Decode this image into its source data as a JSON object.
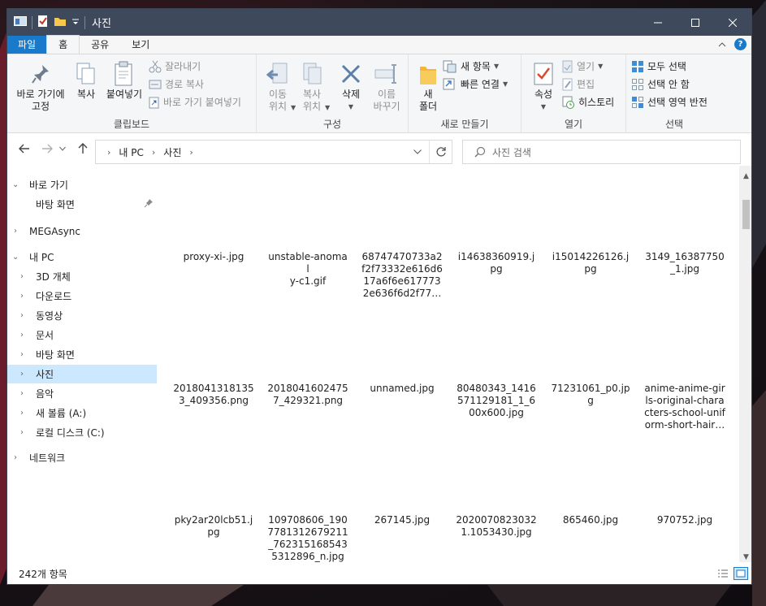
{
  "window": {
    "title": "사진",
    "controls": {
      "minimize": "minimize-icon",
      "maximize": "maximize-icon",
      "close": "close-icon"
    }
  },
  "ribbon_tabs": [
    "파일",
    "홈",
    "공유",
    "보기"
  ],
  "ribbon": {
    "clipboard": {
      "label": "클립보드",
      "pin": "바로 가기에\n고정",
      "copy": "복사",
      "paste": "붙여넣기",
      "cut": "잘라내기",
      "copy_path": "경로 복사",
      "paste_shortcut": "바로 가기 붙여넣기"
    },
    "organize": {
      "label": "구성",
      "move_to": "이동\n위치",
      "copy_to": "복사\n위치",
      "delete": "삭제",
      "rename": "이름\n바꾸기"
    },
    "new": {
      "label": "새로 만들기",
      "new_folder": "새\n폴더",
      "new_item": "새 항목",
      "easy_access": "빠른 연결"
    },
    "open": {
      "label": "열기",
      "properties": "속성",
      "open": "열기",
      "edit": "편집",
      "history": "히스토리"
    },
    "select": {
      "label": "선택",
      "select_all": "모두 선택",
      "select_none": "선택 안 함",
      "invert": "선택 영역 반전"
    }
  },
  "address": {
    "path": [
      "내 PC",
      "사진"
    ],
    "search_placeholder": "사진 검색"
  },
  "nav": {
    "quick_access": "바로 가기",
    "desktop_pinned": "바탕 화면",
    "megasync": "MEGAsync",
    "this_pc": "내 PC",
    "pc_items": [
      "3D 개체",
      "다운로드",
      "동영상",
      "문서",
      "바탕 화면",
      "사진",
      "음악",
      "새 볼륨 (A:)",
      "로컬 디스크 (C:)"
    ],
    "network": "네트워크",
    "selected": "사진"
  },
  "files": [
    [
      "proxy-xi-.jpg",
      "unstable-anomal\ny-c1.gif",
      "68747470733a2\nf2f73332e616d6\n17a6f6e617773\n2e636f6d2f77…",
      "i14638360919.j\npg",
      "i15014226126.j\npg",
      "3149_16387750\n_1.jpg"
    ],
    [
      "2018041318135\n3_409356.png",
      "2018041602475\n7_429321.png",
      "unnamed.jpg",
      "80480343_1416\n571129181_1_6\n00x600.jpg",
      "71231061_p0.jp\ng",
      "anime-anime-gir\nls-original-chara\ncters-school-unif\norm-short-hair…"
    ],
    [
      "pky2ar20lcb51.j\npg",
      "109708606_190\n7781312679211\n_762315168543\n5312896_n.jpg",
      "267145.jpg",
      "2020070823032\n1.1053430.jpg",
      "865460.jpg",
      "970752.jpg"
    ]
  ],
  "status": {
    "item_count": "242개 항목"
  }
}
